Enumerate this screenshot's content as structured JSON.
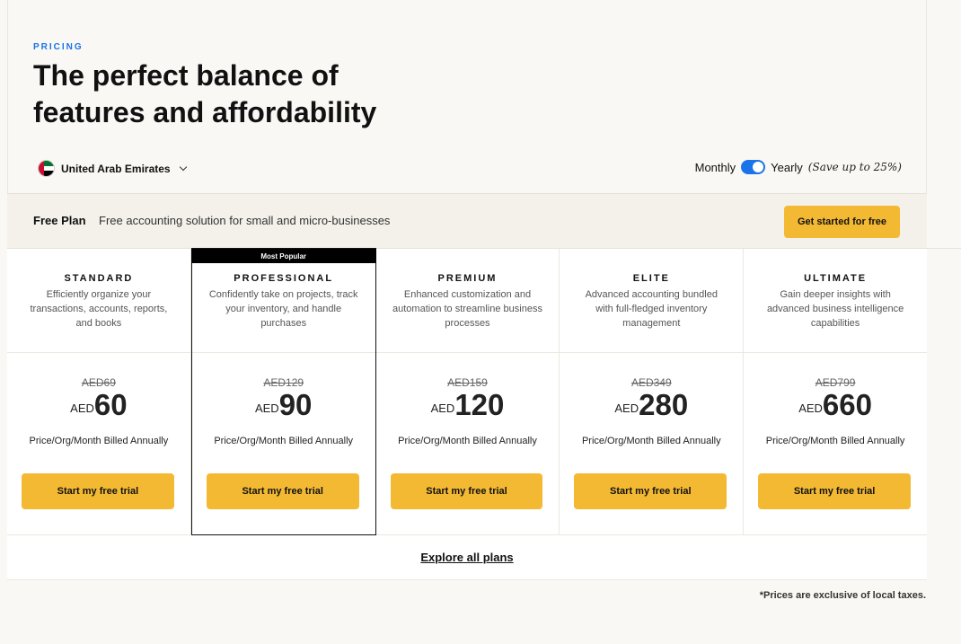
{
  "header": {
    "eyebrow": "PRICING",
    "headline_line1": "The perfect balance of",
    "headline_line2": "features and affordability"
  },
  "region": {
    "label": "United Arab Emirates",
    "flag_icon": "uae-flag-icon"
  },
  "billing": {
    "monthly_label": "Monthly",
    "yearly_label": "Yearly",
    "save_note": "(Save up to 25%)",
    "yearly_selected": true,
    "toggle_color": "#1a73e8"
  },
  "free_plan": {
    "title": "Free Plan",
    "description": "Free accounting solution for small and micro-businesses",
    "cta": "Get started for free"
  },
  "plans": [
    {
      "name": "STANDARD",
      "description": "Efficiently organize your transactions, accounts, reports, and books",
      "old_price": "AED69",
      "currency": "AED",
      "price": "60",
      "period": "Price/Org/Month Billed Annually",
      "cta": "Start my free trial"
    },
    {
      "name": "PROFESSIONAL",
      "badge": "Most Popular",
      "description": "Confidently take on projects, track your inventory, and handle purchases",
      "old_price": "AED129",
      "currency": "AED",
      "price": "90",
      "period": "Price/Org/Month Billed Annually",
      "cta": "Start my free trial"
    },
    {
      "name": "PREMIUM",
      "description": "Enhanced customization and automation to streamline business processes",
      "old_price": "AED159",
      "currency": "AED",
      "price": "120",
      "period": "Price/Org/Month Billed Annually",
      "cta": "Start my free trial"
    },
    {
      "name": "ELITE",
      "description": "Advanced accounting bundled with full-fledged inventory management",
      "old_price": "AED349",
      "currency": "AED",
      "price": "280",
      "period": "Price/Org/Month Billed Annually",
      "cta": "Start my free trial"
    },
    {
      "name": "ULTIMATE",
      "description": "Gain deeper insights with advanced business intelligence capabilities",
      "old_price": "AED799",
      "currency": "AED",
      "price": "660",
      "period": "Price/Org/Month Billed Annually",
      "cta": "Start my free trial"
    }
  ],
  "explore_link": "Explore all plans",
  "tax_note": "*Prices are exclusive of local taxes.",
  "colors": {
    "accent_yellow": "#f4b933",
    "accent_blue": "#1a73e8",
    "background": "#f9f8f4"
  }
}
